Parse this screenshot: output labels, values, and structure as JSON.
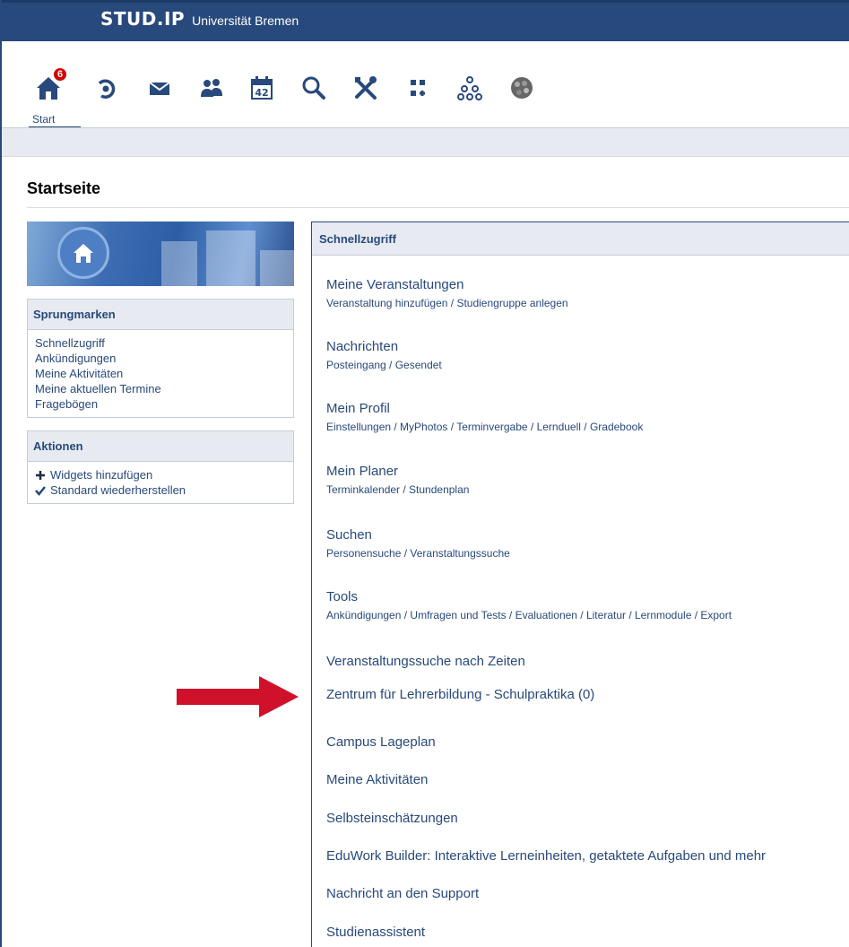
{
  "header": {
    "logo_text": "STUD.IP",
    "university": "Universität Bremen",
    "brand_color": "#28497c"
  },
  "nav": {
    "items": [
      {
        "icon": "home-icon",
        "label": "Start",
        "badge": "6"
      },
      {
        "icon": "activity-icon"
      },
      {
        "icon": "mail-icon"
      },
      {
        "icon": "community-icon"
      },
      {
        "icon": "calendar-icon",
        "calendar_day": "42"
      },
      {
        "icon": "search-icon"
      },
      {
        "icon": "tools-icon"
      },
      {
        "icon": "courseware-icon"
      },
      {
        "icon": "org-icon"
      },
      {
        "icon": "avatar-icon"
      }
    ]
  },
  "page": {
    "title": "Startseite"
  },
  "sidebar": {
    "jumpmarks": {
      "heading": "Sprungmarken",
      "items": [
        "Schnellzugriff",
        "Ankündigungen",
        "Meine Aktivitäten",
        "Meine aktuellen Termine",
        "Fragebögen"
      ]
    },
    "actions": {
      "heading": "Aktionen",
      "items": [
        {
          "icon": "plus-icon",
          "label": "Widgets hinzufügen"
        },
        {
          "icon": "checkmark-icon",
          "label": "Standard wiederherstellen"
        }
      ]
    }
  },
  "quickaccess": {
    "heading": "Schnellzugriff",
    "entries": [
      {
        "title": "Meine Veranstaltungen",
        "sub": "Veranstaltung hinzufügen / Studiengruppe anlegen"
      },
      {
        "title": "Nachrichten",
        "sub": "Posteingang / Gesendet"
      },
      {
        "title": "Mein Profil",
        "sub": "Einstellungen / MyPhotos / Terminvergabe / Lernduell / Gradebook"
      },
      {
        "title": "Mein Planer",
        "sub": "Terminkalender / Stundenplan"
      },
      {
        "title": "Suchen",
        "sub": "Personensuche / Veranstaltungssuche"
      },
      {
        "title": "Tools",
        "sub": "Ankündigungen / Umfragen und Tests / Evaluationen / Literatur / Lernmodule / Export"
      },
      {
        "title": "Veranstaltungssuche nach Zeiten"
      },
      {
        "title": "Zentrum für Lehrerbildung - Schulpraktika (0)"
      },
      {
        "title": "Campus Lageplan"
      },
      {
        "title": "Meine Aktivitäten"
      },
      {
        "title": "Selbsteinschätzungen"
      },
      {
        "title": "EduWork Builder: Interaktive Lerneinheiten, getaktete Aufgaben und mehr"
      },
      {
        "title": "Nachricht an den Support"
      },
      {
        "title": "Studienassistent"
      }
    ]
  },
  "annotation": {
    "arrow_color": "#d0112b"
  }
}
